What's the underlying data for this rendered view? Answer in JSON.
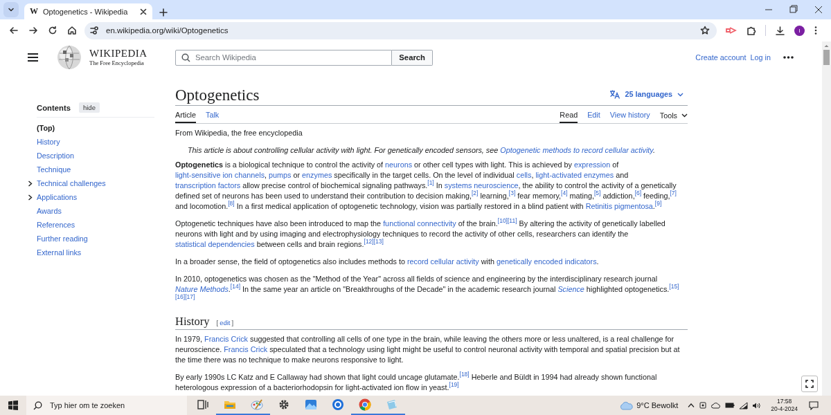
{
  "browser": {
    "favicon": "W",
    "tab_title": "Optogenetics - Wikipedia",
    "url": "en.wikipedia.org/wiki/Optogenetics",
    "profile_initial": "I"
  },
  "header": {
    "wordmark": "WIKIPEDIA",
    "tagline": "The Free Encyclopedia",
    "search_placeholder": "Search Wikipedia",
    "search_button": "Search",
    "user_links": [
      "Create account",
      "Log in"
    ]
  },
  "toc": {
    "title": "Contents",
    "hide_button": "hide",
    "items": [
      {
        "label": "(Top)",
        "selected": true,
        "expandable": false
      },
      {
        "label": "History",
        "selected": false,
        "expandable": false
      },
      {
        "label": "Description",
        "selected": false,
        "expandable": false
      },
      {
        "label": "Technique",
        "selected": false,
        "expandable": false
      },
      {
        "label": "Technical challenges",
        "selected": false,
        "expandable": true
      },
      {
        "label": "Applications",
        "selected": false,
        "expandable": true
      },
      {
        "label": "Awards",
        "selected": false,
        "expandable": false
      },
      {
        "label": "References",
        "selected": false,
        "expandable": false
      },
      {
        "label": "Further reading",
        "selected": false,
        "expandable": false
      },
      {
        "label": "External links",
        "selected": false,
        "expandable": false
      }
    ]
  },
  "article": {
    "title": "Optogenetics",
    "languages": "25 languages",
    "tabs": [
      {
        "label": "Article",
        "selected": true
      },
      {
        "label": "Talk",
        "selected": false
      }
    ],
    "views": [
      {
        "label": "Read",
        "selected": true
      },
      {
        "label": "Edit",
        "selected": false
      },
      {
        "label": "View history",
        "selected": false
      }
    ],
    "tools": "Tools",
    "tagline": "From Wikipedia, the free encyclopedia",
    "hatnote": [
      "This article is about controlling cellular activity with light. For genetically encoded sensors, see ",
      {
        "kind": "link",
        "text": "Optogenetic methods to record cellular activity"
      },
      "."
    ],
    "paragraphs": [
      [
        {
          "kind": "bold",
          "text": "Optogenetics"
        },
        " is a biological technique to control the activity of ",
        {
          "kind": "link",
          "text": "neurons"
        },
        " or other cell types with light. This is achieved by ",
        {
          "kind": "link",
          "text": "expression"
        },
        " of ",
        {
          "kind": "link",
          "text": "light-sensitive ion "
        },
        {
          "kind": "link",
          "text": "channels"
        },
        ", ",
        {
          "kind": "link",
          "text": "pumps"
        },
        " or ",
        {
          "kind": "link",
          "text": "enzymes"
        },
        " specifically in the target cells. On the level of individual ",
        {
          "kind": "link",
          "text": "cells"
        },
        ", ",
        {
          "kind": "link",
          "text": "light-activated enzymes"
        },
        " and ",
        {
          "kind": "link",
          "text": "transcription factors"
        },
        " allow precise control of biochemical signaling pathways.",
        {
          "kind": "ref",
          "text": "[1]"
        },
        " In ",
        {
          "kind": "link",
          "text": "systems neuroscience"
        },
        ", the ability to control the activity of a genetically defined set of neurons has been used to understand their contribution to decision making,",
        {
          "kind": "ref",
          "text": "[2]"
        },
        " learning,",
        {
          "kind": "ref",
          "text": "[3]"
        },
        " fear memory,",
        {
          "kind": "ref",
          "text": "[4]"
        },
        " mating,",
        {
          "kind": "ref",
          "text": "[5]"
        },
        " addiction,",
        {
          "kind": "ref",
          "text": "[6]"
        },
        " feeding,",
        {
          "kind": "ref",
          "text": "[7]"
        },
        " and locomotion.",
        {
          "kind": "ref",
          "text": "[8]"
        },
        " In a first medical application of optogenetic technology, vision was partially restored in a blind patient with ",
        {
          "kind": "link",
          "text": "Retinitis pigmentosa"
        },
        ".",
        {
          "kind": "ref",
          "text": "[9]"
        }
      ],
      [
        "Optogenetic techniques have also been introduced to map the ",
        {
          "kind": "link",
          "text": "functional connectivity"
        },
        " of the brain.",
        {
          "kind": "ref",
          "text": "[10]"
        },
        {
          "kind": "ref",
          "text": "[11]"
        },
        " By altering the activity of genetically labelled neurons with light and by using imaging and electrophysiology techniques to record the activity of other cells, researchers can identify the ",
        {
          "kind": "link",
          "text": "statistical "
        },
        {
          "kind": "link",
          "text": "dependencies"
        },
        " between cells and brain regions.",
        {
          "kind": "ref",
          "text": "[12]"
        },
        {
          "kind": "ref",
          "text": "[13]"
        }
      ],
      [
        "In a broader sense, the field of optogenetics also includes methods to ",
        {
          "kind": "link",
          "text": "record cellular activity"
        },
        " with ",
        {
          "kind": "link",
          "text": "genetically encoded indicators"
        },
        "."
      ],
      [
        "In 2010, optogenetics was chosen as the \"Method of the Year\" across all fields of science and engineering by the interdisciplinary research journal ",
        {
          "kind": "italic-link",
          "text": "Nature Methods"
        },
        ".",
        {
          "kind": "ref",
          "text": "[14]"
        },
        " In the same year an article on \"Breakthroughs of the Decade\" in the academic research journal ",
        {
          "kind": "italic-link",
          "text": "Science"
        },
        " highlighted optogenetics.",
        {
          "kind": "ref",
          "text": "[15]"
        },
        {
          "kind": "ref",
          "text": "[16]"
        },
        {
          "kind": "ref",
          "text": "[17]"
        }
      ]
    ],
    "sections": [
      {
        "heading": "History",
        "edit_open": "[",
        "edit": "edit",
        "edit_close": "]",
        "paragraphs": [
          [
            "In 1979, ",
            {
              "kind": "link",
              "text": "Francis Crick"
            },
            " suggested that controlling all cells of one type in the brain, while leaving the others more or less unaltered, is a real challenge for neuroscience. ",
            {
              "kind": "link",
              "text": "Francis Crick"
            },
            " speculated that a technology using light might be useful to control neuronal activity with temporal and spatial precision but at the time there was no technique to make neurons responsive to light."
          ],
          [
            "By early 1990s LC Katz and E Callaway had shown that light could uncage glutamate.",
            {
              "kind": "ref",
              "text": "[18]"
            },
            " Heberle and Büldt in 1994 had already shown functional heterologous expression of a bacteriorhodopsin for light-activated ion flow in yeast.",
            {
              "kind": "ref",
              "text": "[19]"
            }
          ]
        ]
      }
    ]
  },
  "taskbar": {
    "search_placeholder": "Typ hier om te zoeken",
    "apps": [
      {
        "kind": "taskview",
        "running": false
      },
      {
        "kind": "folder",
        "running": true
      },
      {
        "kind": "paint",
        "running": true
      },
      {
        "kind": "settings",
        "running": false
      },
      {
        "kind": "photos",
        "running": false
      },
      {
        "kind": "app",
        "running": false
      },
      {
        "kind": "chrome",
        "running": true
      },
      {
        "kind": "notepad",
        "running": true
      }
    ],
    "weather": "9°C Bewolkt",
    "time": "17:58",
    "date": "20-4-2024"
  }
}
